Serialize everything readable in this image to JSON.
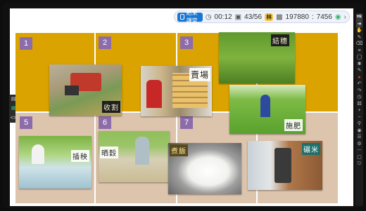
{
  "topbar": {
    "end_label": "結束課堂",
    "timer": "00:12",
    "page": "43/56",
    "lin_badge": "林",
    "room": "197880",
    "code": "7456",
    "icons": [
      "clock-icon",
      "page-icon",
      "room-icon",
      "signal-icon",
      "chevron-right-icon"
    ]
  },
  "left_panel": {
    "icons": [
      "folder-icon",
      "grid-icon",
      "code-icon"
    ]
  },
  "toolbar": {
    "items": [
      "HE",
      "select",
      "pan",
      "pen",
      "eraser",
      "ruler",
      "shape",
      "laser",
      "highlighter",
      "color-red",
      "undo",
      "redo",
      "timer",
      "dice",
      "plus",
      "minus",
      "zoom",
      "camera",
      "list",
      "settings",
      "more",
      "page",
      "exit"
    ]
  },
  "slide": {
    "cells": [
      {
        "number": "1"
      },
      {
        "number": "2"
      },
      {
        "number": "3"
      },
      {
        "number": "5"
      },
      {
        "number": "6"
      },
      {
        "number": "7"
      }
    ],
    "captions": {
      "harvest": "收割",
      "sell": "賣場",
      "ear": "結穗",
      "fertilize": "施肥",
      "transplant": "插秧",
      "dry": "晒穀",
      "cook": "煮飯",
      "mill": "碾米"
    }
  }
}
